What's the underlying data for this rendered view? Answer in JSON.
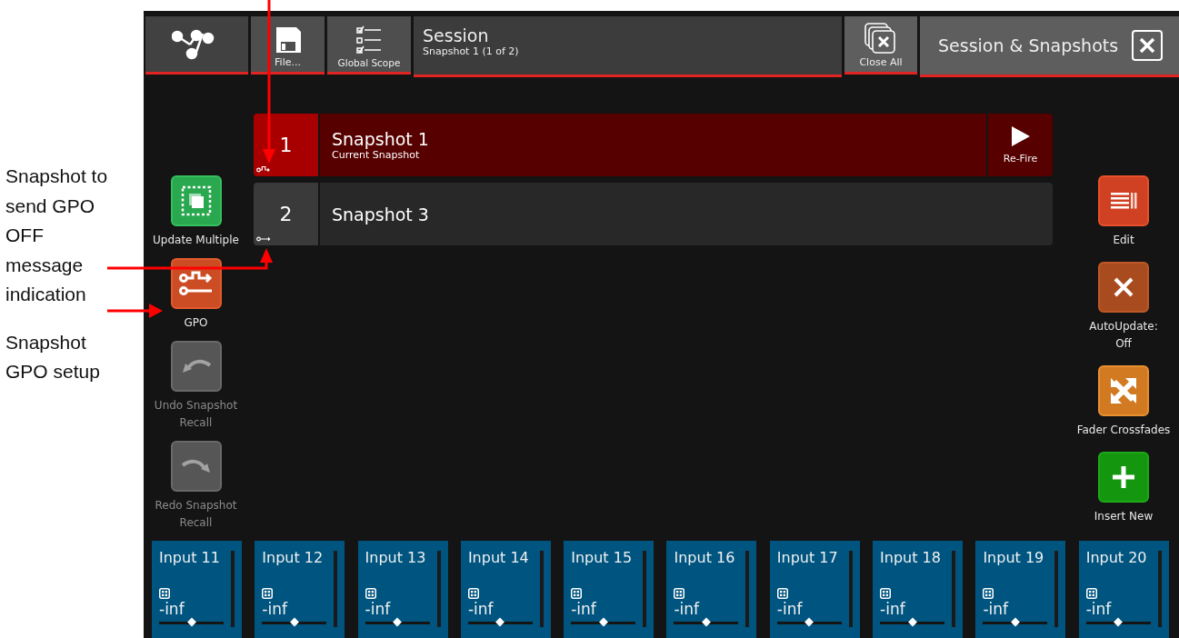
{
  "annotations": [
    {
      "text": "Snapshot to send GPO OFF message indication"
    },
    {
      "text": "Snapshot GPO setup"
    }
  ],
  "toolbar": [
    {
      "kind": "routing"
    },
    {
      "kind": "file",
      "label": "File..."
    },
    {
      "kind": "scope",
      "label": "Global Scope"
    },
    {
      "kind": "title",
      "title": "Session",
      "subtitle": "Snapshot 1 (1 of 2)"
    },
    {
      "kind": "close_all",
      "label": "Close All"
    },
    {
      "kind": "panel",
      "title": "Session & Snapshots"
    }
  ],
  "left_buttons": [
    {
      "kind": "update",
      "label": "Update Multiple",
      "disabled": false
    },
    {
      "kind": "gpo",
      "label": "GPO",
      "disabled": false
    },
    {
      "kind": "undo",
      "label": "Undo Snapshot Recall",
      "disabled": true
    },
    {
      "kind": "redo",
      "label": "Redo Snapshot Recall",
      "disabled": true
    }
  ],
  "snapshots": [
    {
      "number": "1",
      "name": "Snapshot 1",
      "status": "Current Snapshot",
      "selected": true,
      "gpo_active": true,
      "action": "Re-Fire"
    },
    {
      "number": "2",
      "name": "Snapshot 3",
      "selected": false,
      "gpo_active": false
    }
  ],
  "right_buttons": [
    {
      "kind": "edit",
      "label": "Edit"
    },
    {
      "kind": "autoupdate",
      "label": "AutoUpdate: Off"
    },
    {
      "kind": "crossfade",
      "label": "Fader Crossfades"
    },
    {
      "kind": "insert",
      "label": "Insert New"
    }
  ],
  "channels": [
    {
      "name": "Input 11",
      "reading": "-inf",
      "level": 0.5
    },
    {
      "name": "Input 12",
      "reading": "-inf",
      "level": 0.5
    },
    {
      "name": "Input 13",
      "reading": "-inf",
      "level": 0.5
    },
    {
      "name": "Input 14",
      "reading": "-inf",
      "level": 0.5
    },
    {
      "name": "Input 15",
      "reading": "-inf",
      "level": 0.5
    },
    {
      "name": "Input 16",
      "reading": "-inf",
      "level": 0.5
    },
    {
      "name": "Input 17",
      "reading": "-inf",
      "level": 0.5
    },
    {
      "name": "Input 18",
      "reading": "-inf",
      "level": 0.5
    },
    {
      "name": "Input 19",
      "reading": "-inf",
      "level": 0.5
    },
    {
      "name": "Input 20",
      "reading": "-inf",
      "level": 0.5
    }
  ]
}
